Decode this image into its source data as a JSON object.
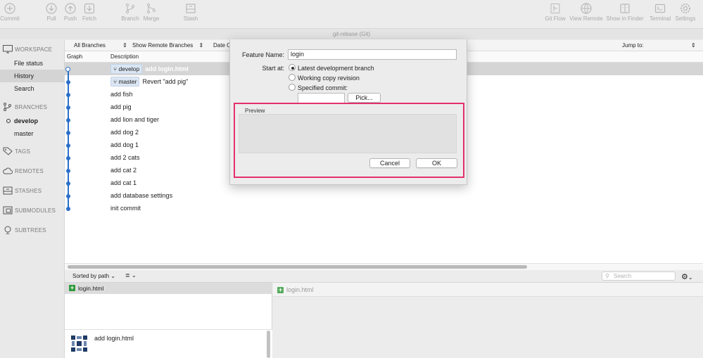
{
  "toolbar": {
    "commit": "Commit",
    "pull": "Pull",
    "push": "Push",
    "fetch": "Fetch",
    "branch": "Branch",
    "merge": "Merge",
    "stash": "Stash",
    "git_flow": "Git Flow",
    "view_remote": "View Remote",
    "show_in_finder": "Show in Finder",
    "terminal": "Terminal",
    "settings": "Settings"
  },
  "window_title": "git-rebase (Git)",
  "sidebar": {
    "workspace": "WORKSPACE",
    "file_status": "File status",
    "history": "History",
    "search": "Search",
    "branches": "BRANCHES",
    "develop": "develop",
    "master": "master",
    "tags": "TAGS",
    "remotes": "REMOTES",
    "stashes": "STASHES",
    "submodules": "SUBMODULES",
    "subtrees": "SUBTREES"
  },
  "filters": {
    "branches": "All Branches",
    "remote": "Show Remote Branches",
    "date": "Date O",
    "jump_to": "Jump to:"
  },
  "columns": {
    "graph": "Graph",
    "description": "Description"
  },
  "commits": [
    {
      "branch": "develop",
      "message": "add login.html"
    },
    {
      "branch": "master",
      "message": "Revert \"add pig\""
    },
    {
      "message": "add fish"
    },
    {
      "message": "add pig"
    },
    {
      "message": "add lion and tiger"
    },
    {
      "message": "add dog 2"
    },
    {
      "message": "add dog 1"
    },
    {
      "message": "add 2 cats"
    },
    {
      "message": "add cat 2"
    },
    {
      "message": "add cat 1"
    },
    {
      "message": "add database settings"
    },
    {
      "message": "init commit"
    }
  ],
  "bottom": {
    "sort": "Sorted by path",
    "search_placeholder": "Search",
    "file": "login.html",
    "diff_file": "login.html",
    "commit_message": "add login.html"
  },
  "dialog": {
    "feature_name_label": "Feature Name:",
    "feature_name_value": "login",
    "start_at_label": "Start at:",
    "option_latest": "Latest development branch",
    "option_working": "Working copy revision",
    "option_specified": "Specified commit:",
    "pick_button": "Pick...",
    "preview_label": "Preview",
    "cancel_button": "Cancel",
    "ok_button": "OK"
  },
  "colors": {
    "graph": "#2a6fc9",
    "highlight": "#e4306b",
    "added": "#2f9a3b"
  }
}
